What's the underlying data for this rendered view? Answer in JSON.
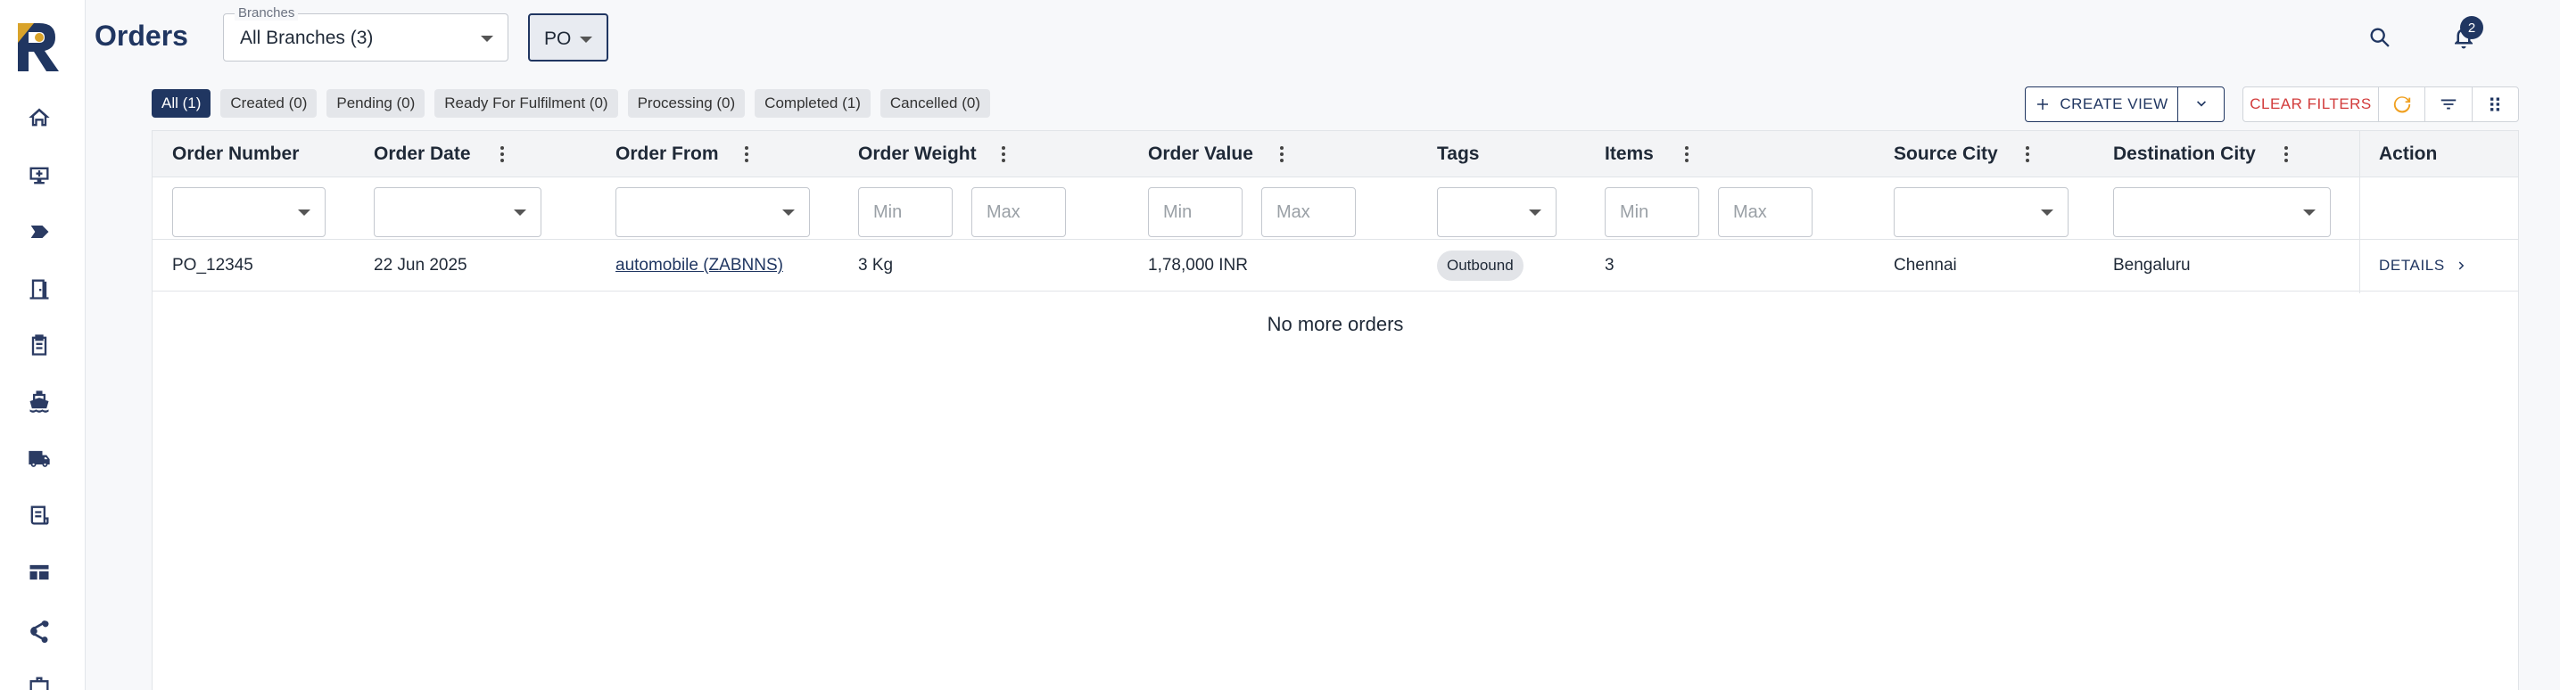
{
  "header": {
    "title": "Orders",
    "branches_label": "Branches",
    "branches_value": "All Branches (3)",
    "type_value": "PO",
    "notification_count": "2"
  },
  "chips": [
    {
      "label": "All (1)",
      "active": true
    },
    {
      "label": "Created (0)",
      "active": false
    },
    {
      "label": "Pending (0)",
      "active": false
    },
    {
      "label": "Ready For Fulfilment (0)",
      "active": false
    },
    {
      "label": "Processing (0)",
      "active": false
    },
    {
      "label": "Completed (1)",
      "active": false
    },
    {
      "label": "Cancelled (0)",
      "active": false
    }
  ],
  "toolbar": {
    "create_view": "CREATE VIEW",
    "clear_filters": "CLEAR FILTERS"
  },
  "table": {
    "columns": [
      "Order Number",
      "Order Date",
      "Order From",
      "Order Weight",
      "Order Value",
      "Tags",
      "Items",
      "Source City",
      "Destination City",
      "Action"
    ],
    "placeholders": {
      "min": "Min",
      "max": "Max"
    },
    "rows": [
      {
        "order_number": "PO_12345",
        "order_date": "22 Jun 2025",
        "order_from": "automobile (ZABNNS)",
        "order_weight": "3 Kg",
        "order_value": "1,78,000 INR",
        "tag": "Outbound",
        "items": "3",
        "source_city": "Chennai",
        "destination_city": "Bengaluru",
        "action": "DETAILS"
      }
    ],
    "footer": "No more orders"
  },
  "colors": {
    "primary": "#203661",
    "danger": "#d23b3b",
    "refresh": "#f0a020"
  },
  "icons": [
    "logo",
    "home-icon",
    "monitor-add-icon",
    "label-icon",
    "door-icon",
    "clipboard-icon",
    "ship-icon",
    "truck-icon",
    "receipt-icon",
    "dashboard-icon",
    "share-icon",
    "briefcase-icon",
    "search-icon",
    "bell-icon",
    "plus-icon",
    "chevron-down-icon",
    "refresh-icon",
    "filter-icon",
    "grid-icon",
    "chevron-right-icon"
  ]
}
